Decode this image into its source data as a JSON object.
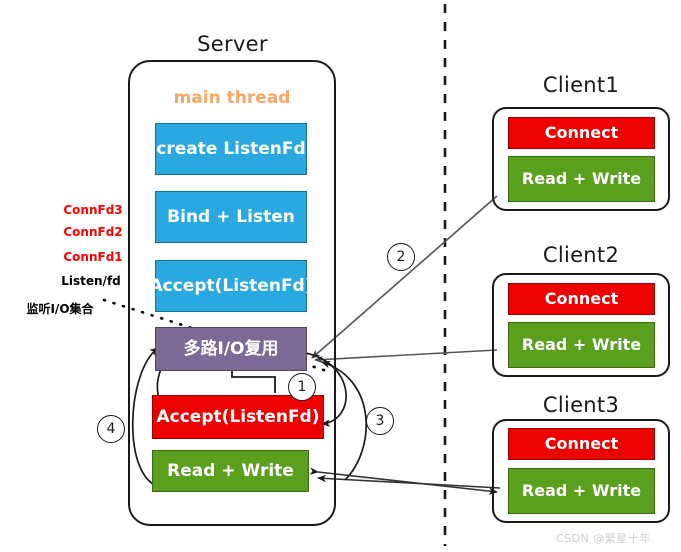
{
  "server": {
    "title": "Server",
    "thread_label": "main thread",
    "blocks": [
      {
        "label": "create ListenFd",
        "color": "#29a9e0"
      },
      {
        "label": "Bind + Listen",
        "color": "#29a9e0"
      },
      {
        "label": "Accept(ListenFd)",
        "color": "#29a9e0"
      },
      {
        "label": "多路I/O复用",
        "color": "#7b6a96"
      },
      {
        "label": "Accept(ListenFd)",
        "color": "#ed0000"
      },
      {
        "label": "Read + Write",
        "color": "#5aa01e"
      }
    ]
  },
  "fd_labels": [
    {
      "text": "ConnFd3",
      "color": "#ff0000"
    },
    {
      "text": "ConnFd2",
      "color": "#ff0000"
    },
    {
      "text": "ConnFd1",
      "color": "#ff0000"
    },
    {
      "text": "Listen/fd",
      "color": "#000000"
    },
    {
      "text": "监听I/O集合",
      "color": "#000000"
    }
  ],
  "clients": [
    {
      "title": "Client1",
      "connect": "Connect",
      "readwrite": "Read + Write"
    },
    {
      "title": "Client2",
      "connect": "Connect",
      "readwrite": "Read + Write"
    },
    {
      "title": "Client3",
      "connect": "Connect",
      "readwrite": "Read + Write"
    }
  ],
  "step_markers": [
    "1",
    "2",
    "3",
    "4"
  ],
  "watermark": "CSDN @繁星十年",
  "colors": {
    "blue": "#29a9e0",
    "purple": "#7b6a96",
    "red": "#ed0000",
    "green": "#5aa01e",
    "orange": "#f9a764",
    "label_red": "#ff0000",
    "stroke": "#1a1a1a"
  }
}
